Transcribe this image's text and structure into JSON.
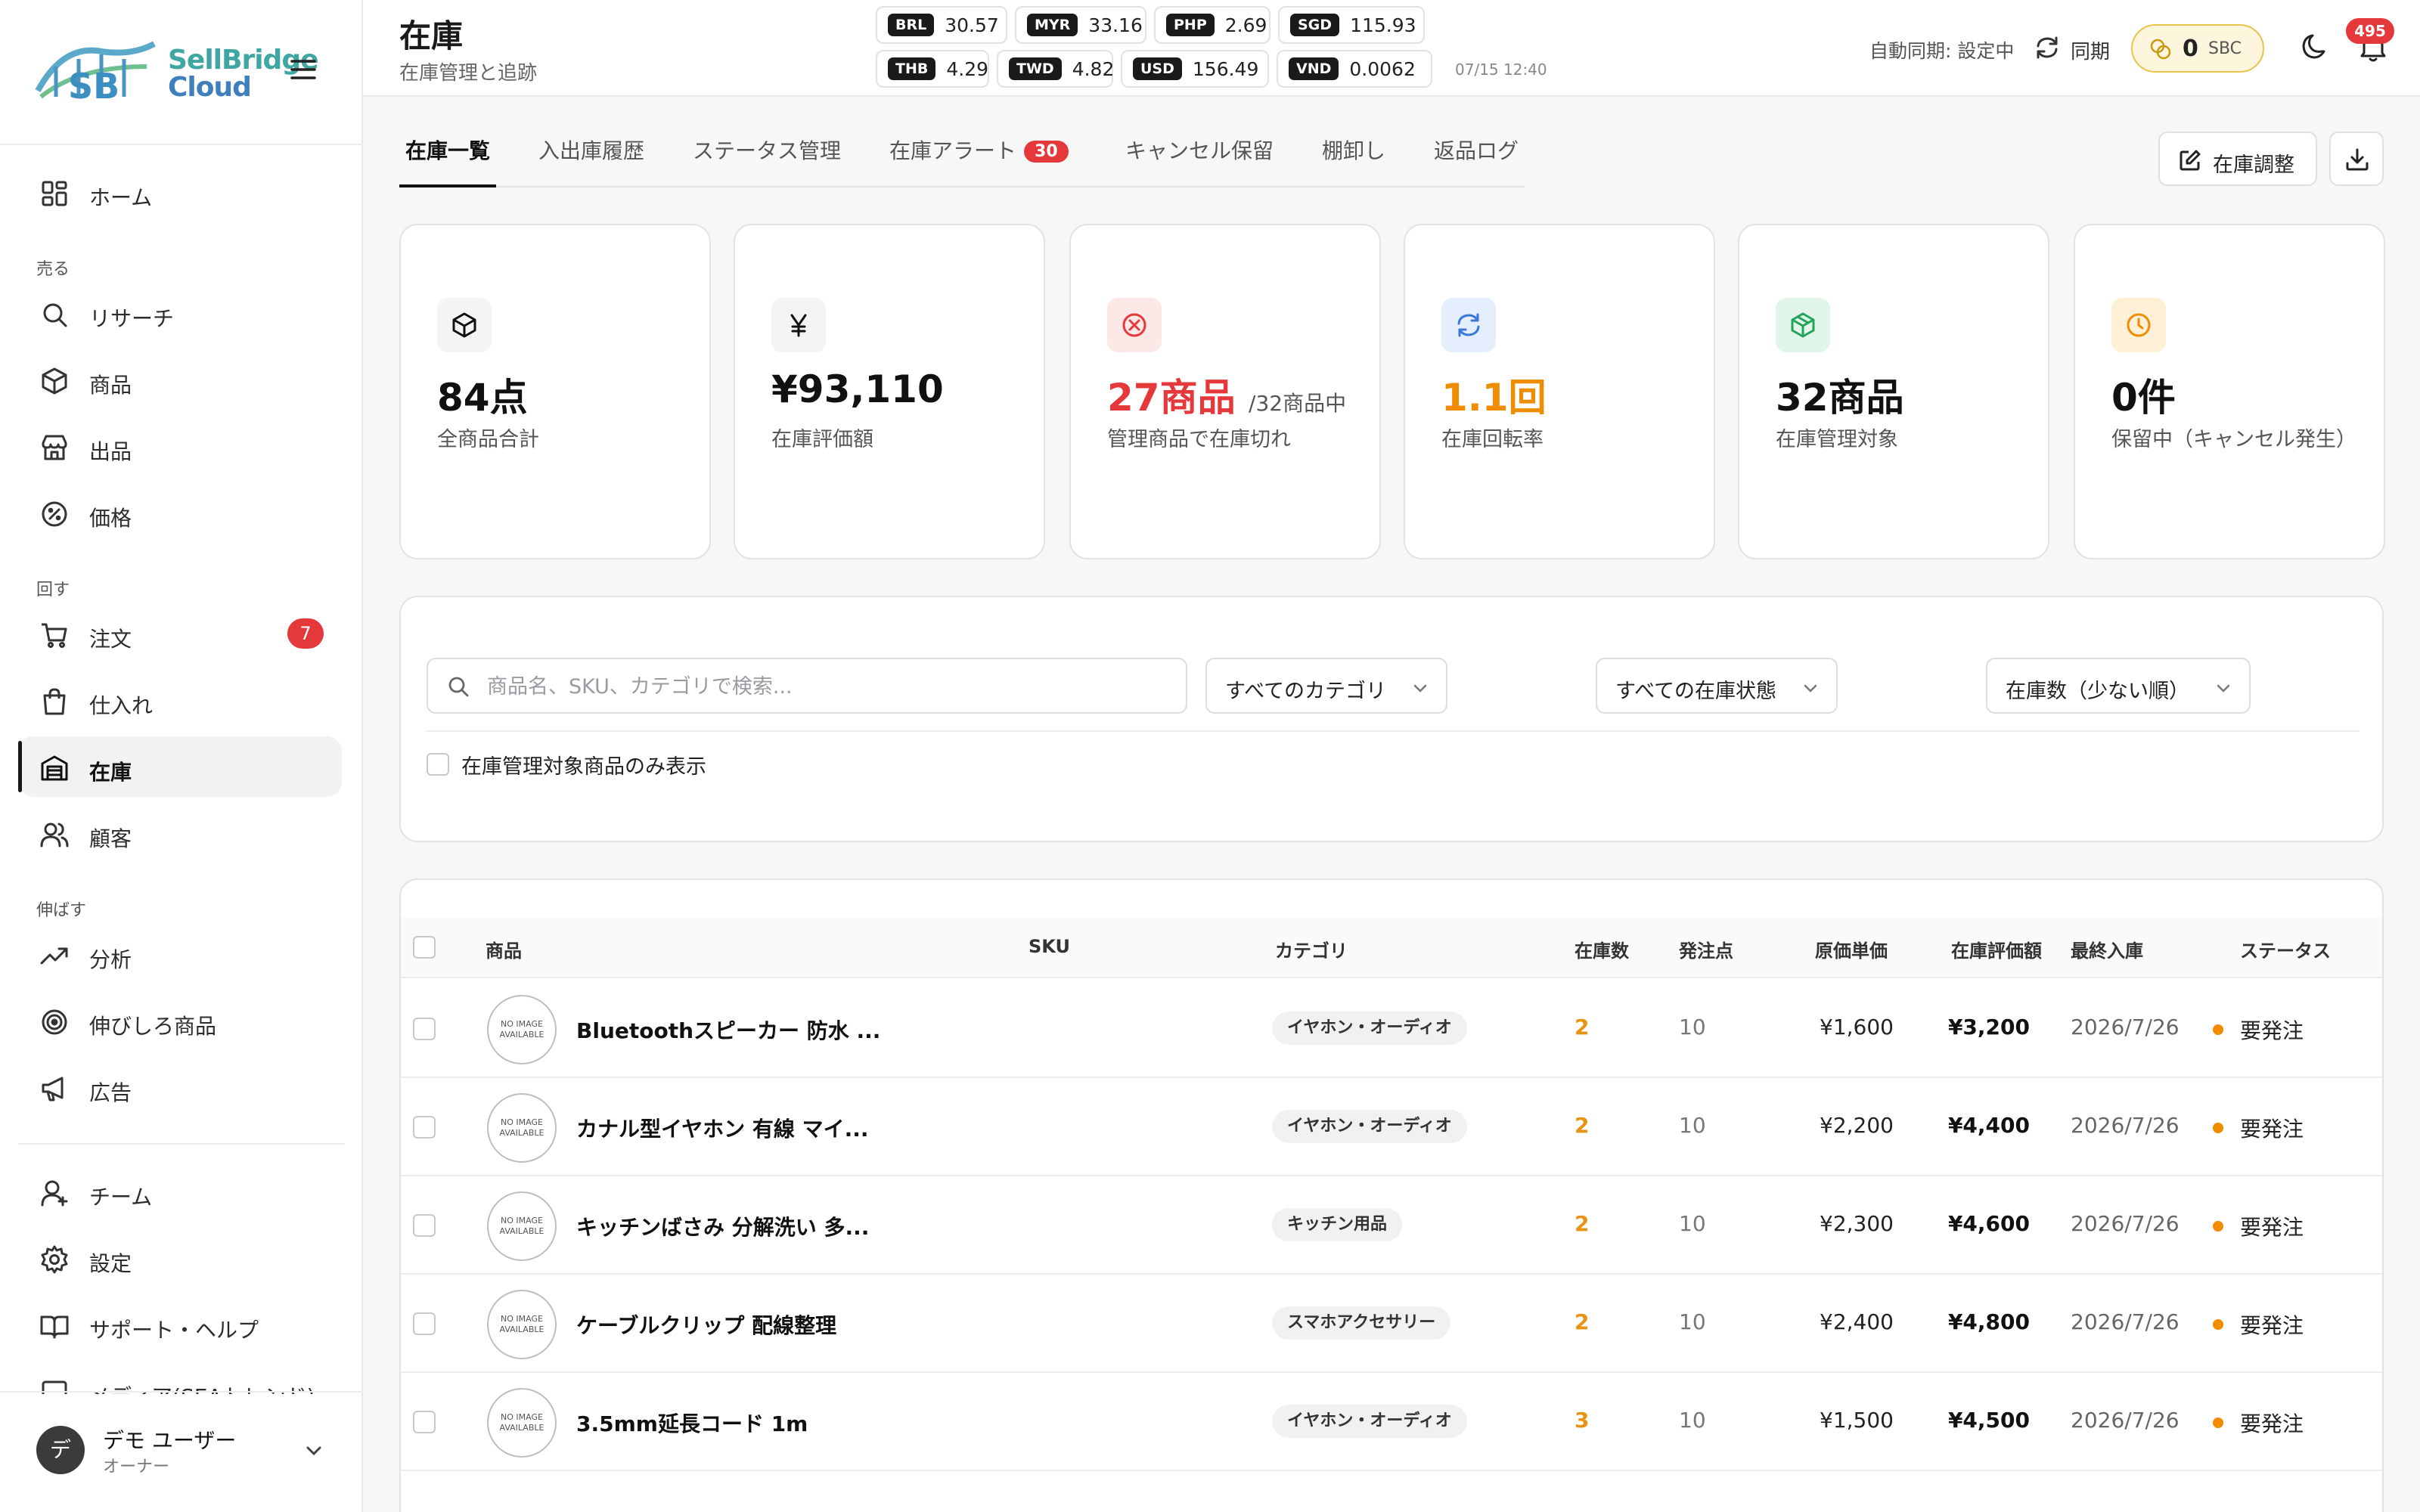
{
  "brand": {
    "name_line1": "SellBridge",
    "name_line2": "Cloud"
  },
  "sidebar": {
    "home": "ホーム",
    "sections": [
      {
        "label": "売る",
        "items": [
          "リサーチ",
          "商品",
          "出品",
          "価格"
        ]
      },
      {
        "label": "回す",
        "items": [
          "注文",
          "仕入れ",
          "在庫",
          "顧客"
        ]
      },
      {
        "label": "伸ばす",
        "items": [
          "分析",
          "伸びしろ商品",
          "広告"
        ]
      }
    ],
    "orders_badge": "7",
    "bottom_items": [
      "チーム",
      "設定",
      "サポート・ヘルプ",
      "メディア(SEAトレンド)"
    ],
    "active": "在庫",
    "user": {
      "avatar": "デ",
      "name": "デモ ユーザー",
      "role": "オーナー"
    }
  },
  "header": {
    "title": "在庫",
    "subtitle": "在庫管理と追跡",
    "fx_rates": [
      {
        "code": "BRL",
        "rate": "30.57"
      },
      {
        "code": "MYR",
        "rate": "33.16"
      },
      {
        "code": "PHP",
        "rate": "2.69"
      },
      {
        "code": "SGD",
        "rate": "115.93"
      },
      {
        "code": "THB",
        "rate": "4.29"
      },
      {
        "code": "TWD",
        "rate": "4.82"
      },
      {
        "code": "USD",
        "rate": "156.49"
      },
      {
        "code": "VND",
        "rate": "0.0062"
      }
    ],
    "fx_time": "07/15 12:40",
    "auto_sync": "自動同期: 設定中",
    "sync_label": "同期",
    "sbc": {
      "value": "0",
      "unit": "SBC"
    },
    "notification_count": "495"
  },
  "tabs": [
    {
      "label": "在庫一覧"
    },
    {
      "label": "入出庫履歴"
    },
    {
      "label": "ステータス管理"
    },
    {
      "label": "在庫アラート",
      "badge": "30"
    },
    {
      "label": "キャンセル保留"
    },
    {
      "label": "棚卸し"
    },
    {
      "label": "返品ログ"
    }
  ],
  "actions": {
    "adjust": "在庫調整"
  },
  "stats": [
    {
      "value": "84点",
      "suffix": "",
      "desc": "全商品合計",
      "icon": "box-icon",
      "color": "#111111"
    },
    {
      "value": "¥93,110",
      "suffix": "",
      "desc": "在庫評価額",
      "icon": "yen-icon",
      "color": "#111111"
    },
    {
      "value": "27商品",
      "suffix": "/32商品中",
      "desc": "管理商品で在庫切れ",
      "icon": "x-circle-icon",
      "color": "#e5383b"
    },
    {
      "value": "1.1回",
      "suffix": "",
      "desc": "在庫回転率",
      "icon": "refresh-icon",
      "color": "#f08c00"
    },
    {
      "value": "32商品",
      "suffix": "",
      "desc": "在庫管理対象",
      "icon": "package-icon",
      "color": "#111111"
    },
    {
      "value": "0件",
      "suffix": "",
      "desc": "保留中（キャンセル発生）",
      "icon": "clock-icon",
      "color": "#111111"
    }
  ],
  "filters": {
    "search_placeholder": "商品名、SKU、カテゴリで検索...",
    "category": "すべてのカテゴリ",
    "stock_status": "すべての在庫状態",
    "sort": "在庫数（少ない順）",
    "managed_only": "在庫管理対象商品のみ表示"
  },
  "table": {
    "columns": [
      "商品",
      "SKU",
      "カテゴリ",
      "在庫数",
      "発注点",
      "原価単価",
      "在庫評価額",
      "最終入庫",
      "ステータス"
    ],
    "no_image": "NO IMAGE AVAILABLE",
    "rows": [
      {
        "name": "Bluetoothスピーカー 防水 ...",
        "sku": "",
        "category": "イヤホン・オーディオ",
        "stock": "2",
        "reorder": "10",
        "cost": "¥1,600",
        "valuation": "¥3,200",
        "last_in": "2026/7/26",
        "status": "要発注"
      },
      {
        "name": "カナル型イヤホン 有線 マイ...",
        "sku": "",
        "category": "イヤホン・オーディオ",
        "stock": "2",
        "reorder": "10",
        "cost": "¥2,200",
        "valuation": "¥4,400",
        "last_in": "2026/7/26",
        "status": "要発注"
      },
      {
        "name": "キッチンばさみ 分解洗い 多...",
        "sku": "",
        "category": "キッチン用品",
        "stock": "2",
        "reorder": "10",
        "cost": "¥2,300",
        "valuation": "¥4,600",
        "last_in": "2026/7/26",
        "status": "要発注"
      },
      {
        "name": "ケーブルクリップ 配線整理",
        "sku": "",
        "category": "スマホアクセサリー",
        "stock": "2",
        "reorder": "10",
        "cost": "¥2,400",
        "valuation": "¥4,800",
        "last_in": "2026/7/26",
        "status": "要発注"
      },
      {
        "name": "3.5mm延長コード 1m",
        "sku": "",
        "category": "イヤホン・オーディオ",
        "stock": "3",
        "reorder": "10",
        "cost": "¥1,500",
        "valuation": "¥4,500",
        "last_in": "2026/7/26",
        "status": "要発注"
      }
    ]
  }
}
